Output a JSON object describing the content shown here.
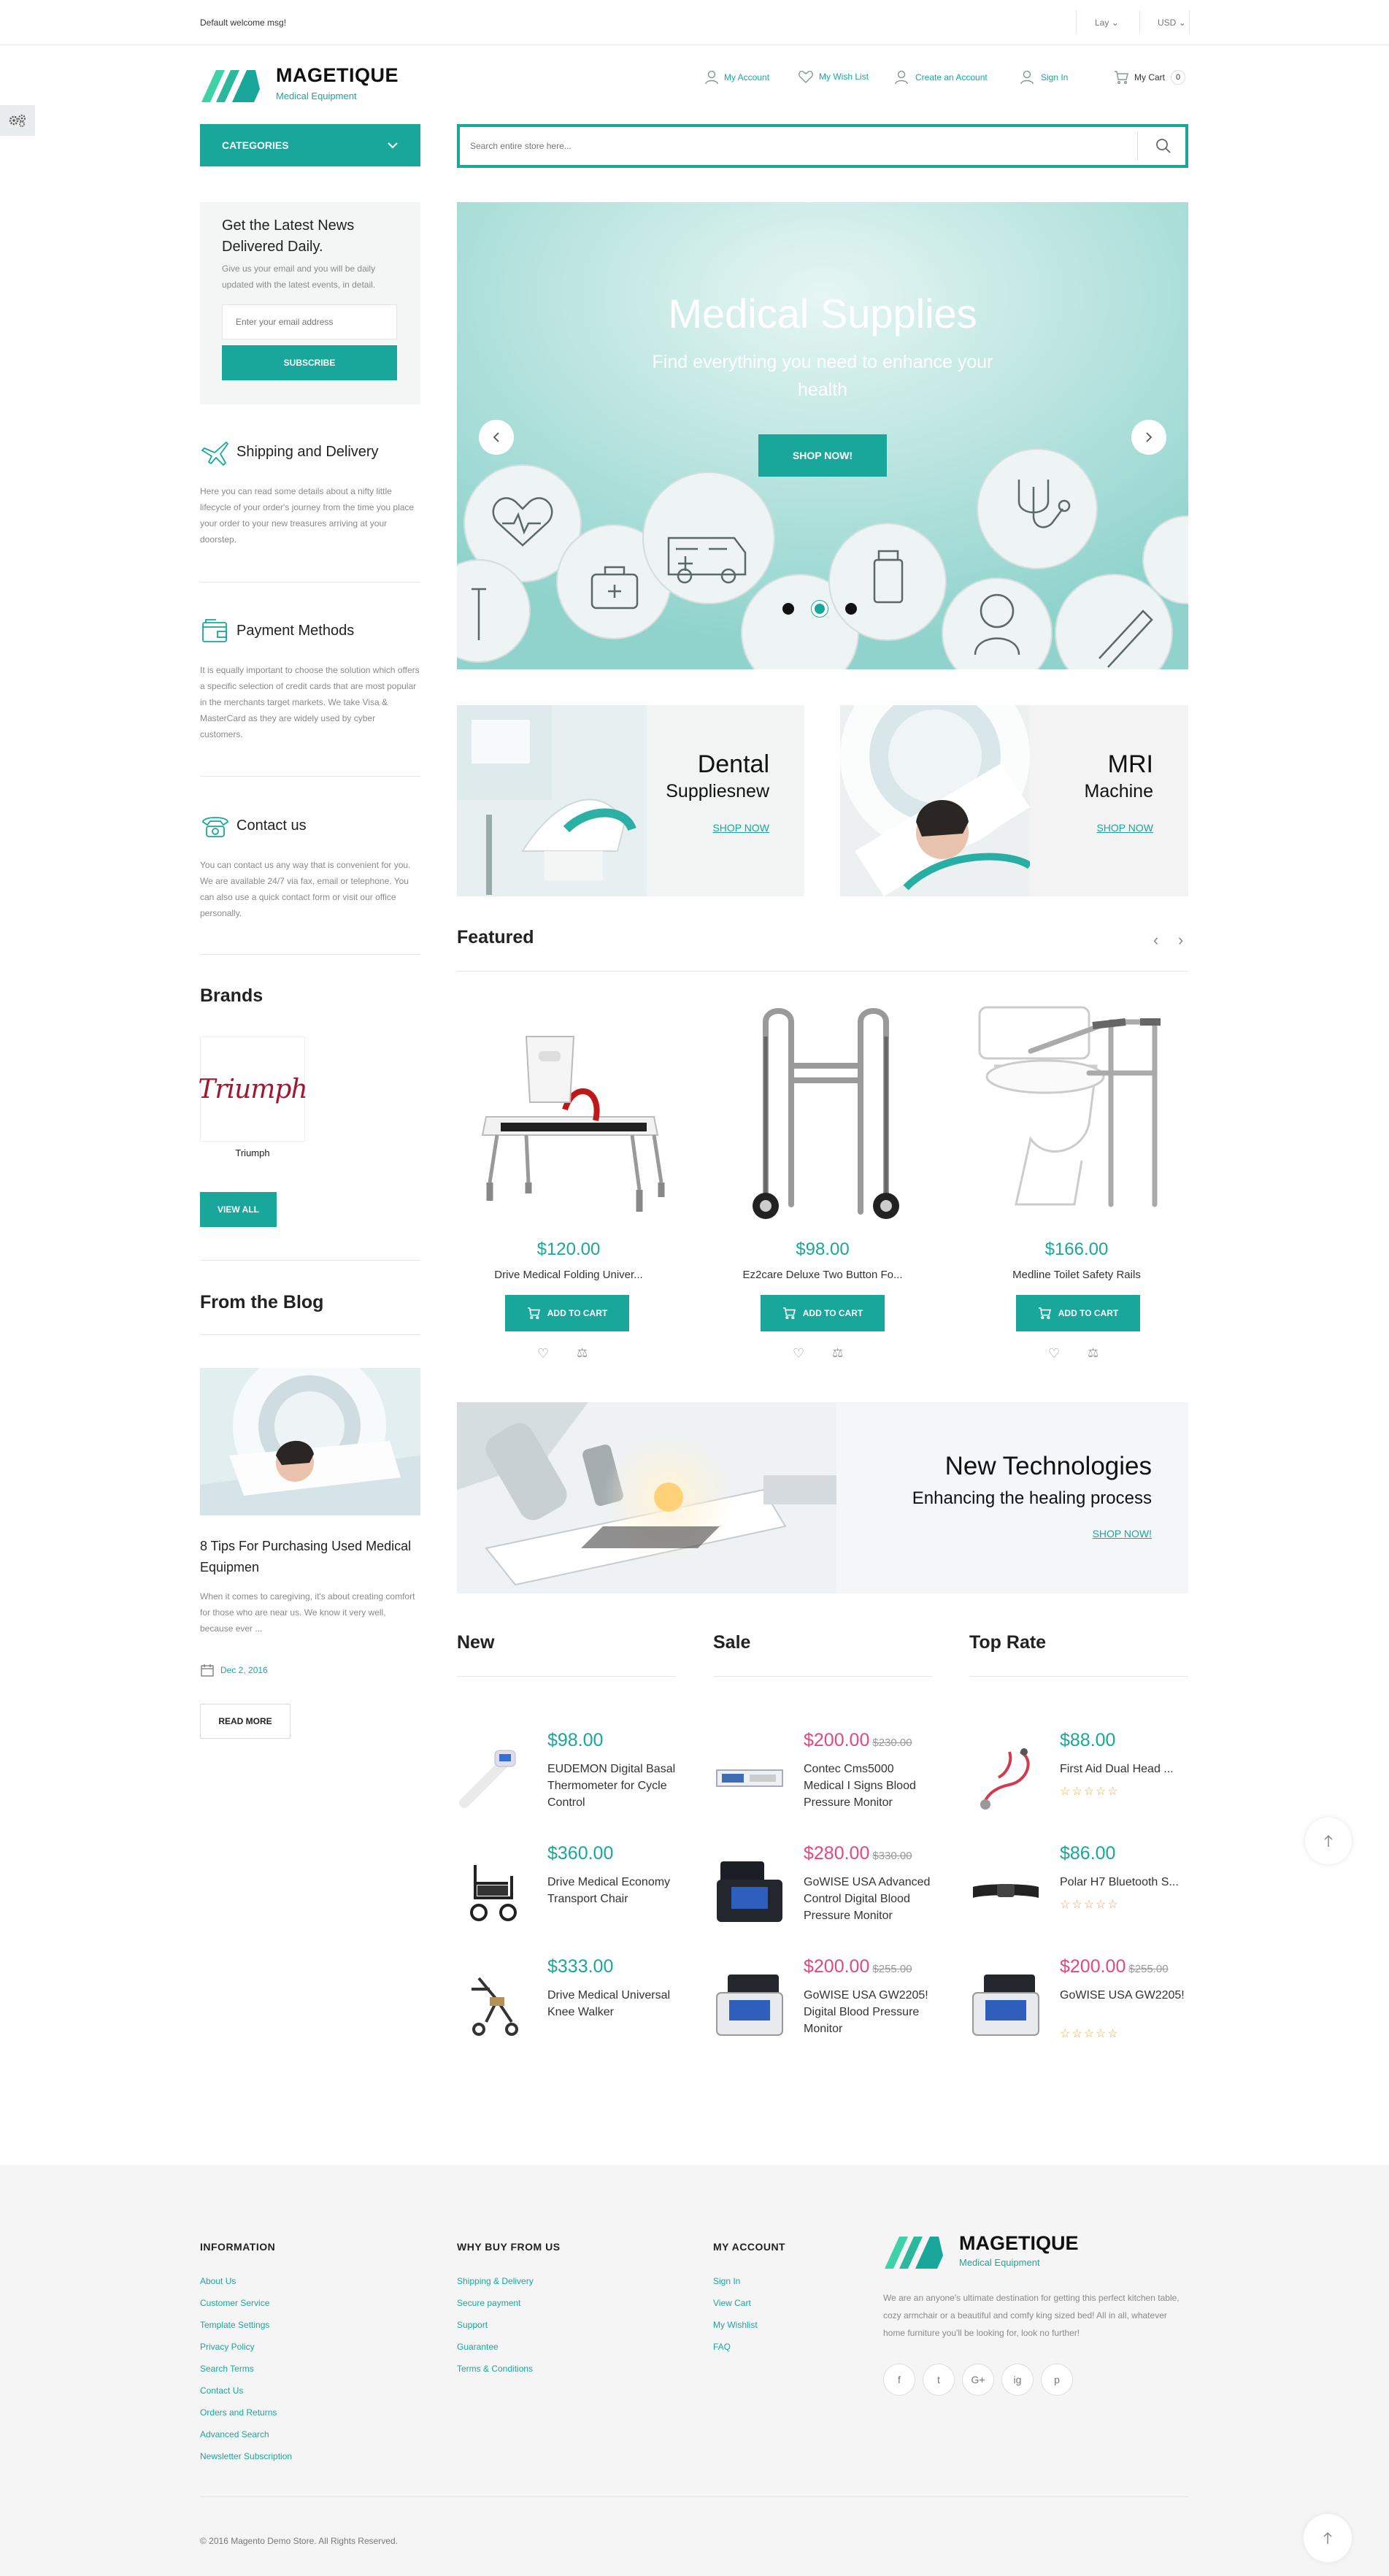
{
  "topbar": {
    "welcome": "Default welcome msg!",
    "language": "Lay",
    "currency": "USD"
  },
  "brand": {
    "name": "MAGETIQUE",
    "tagline": "Medical Equipment"
  },
  "header_links": {
    "account": "My Account",
    "wishlist": "My Wish List",
    "create": "Create an Account",
    "signin": "Sign In",
    "cart": "My Cart",
    "cart_count": "0"
  },
  "categories_label": "CATEGORIES",
  "search": {
    "placeholder": "Search entire store here..."
  },
  "newsletter": {
    "title": "Get the Latest News Delivered Daily.",
    "text": "Give us your email and you will be daily updated with the latest events, in detail.",
    "placeholder": "Enter your email address",
    "button": "SUBSCRIBE"
  },
  "info_blocks": [
    {
      "title": "Shipping and Delivery",
      "icon": "airplane-icon",
      "text": "Here you can read some details about a nifty little lifecycle of your order's journey from the time you place your order to your new treasures arriving at your doorstep."
    },
    {
      "title": "Payment Methods",
      "icon": "wallet-icon",
      "text": "It is equally important to choose the solution which offers a specific selection of credit cards that are most popular in the merchants target markets. We take Visa & MasterCard as they are widely used by cyber customers."
    },
    {
      "title": "Contact us",
      "icon": "phone-icon",
      "text": "You can contact us any way that is convenient for you. We are available 24/7 via fax, email or telephone. You can also use a quick contact form or visit our office personally."
    }
  ],
  "brands": {
    "title": "Brands",
    "logo_text": "Triumph",
    "name": "Triumph",
    "button": "VIEW ALL"
  },
  "blog": {
    "title": "From the Blog",
    "post_title": "8 Tips For Purchasing Used Medical Equipmen",
    "excerpt": "When it comes to caregiving, it's about creating comfort for those who are near us. We know it very well, because ever ...",
    "date": "Dec 2, 2016",
    "button": "READ MORE"
  },
  "hero": {
    "title": "Medical Supplies",
    "subtitle": "Find everything you need to enhance your health",
    "button": "SHOP NOW!",
    "slides": 3,
    "active_slide": 2
  },
  "banners": [
    {
      "title": "Dental",
      "subtitle": "Suppliesnew",
      "link": "SHOP NOW"
    },
    {
      "title": "MRI",
      "subtitle": "Machine",
      "link": "SHOP NOW"
    }
  ],
  "featured": {
    "title": "Featured",
    "add_label": "ADD TO CART",
    "products": [
      {
        "price": "$120.00",
        "name": "Drive Medical Folding Univer..."
      },
      {
        "price": "$98.00",
        "name": "Ez2care Deluxe Two Button Fo..."
      },
      {
        "price": "$166.00",
        "name": "Medline Toilet Safety Rails"
      }
    ]
  },
  "tech_banner": {
    "title": "New Technologies",
    "subtitle": "Enhancing the healing process",
    "link": "SHOP NOW!"
  },
  "lists": [
    {
      "title": "New",
      "items": [
        {
          "price": "$98.00",
          "old": "",
          "name": "EUDEMON Digital Basal Thermometer for Cycle Control"
        },
        {
          "price": "$360.00",
          "old": "",
          "name": "Drive Medical Economy Transport Chair"
        },
        {
          "price": "$333.00",
          "old": "",
          "name": "Drive Medical Universal Knee Walker"
        }
      ]
    },
    {
      "title": "Sale",
      "items": [
        {
          "price": "$200.00",
          "old": "$230.00",
          "name": "Contec Cms5000 Medical I Signs Blood Pressure Monitor"
        },
        {
          "price": "$280.00",
          "old": "$330.00",
          "name": "GoWISE USA Advanced Control Digital Blood Pressure Monitor"
        },
        {
          "price": "$200.00",
          "old": "$255.00",
          "name": "GoWISE USA GW2205! Digital Blood Pressure Monitor"
        }
      ]
    },
    {
      "title": "Top Rate",
      "items": [
        {
          "price": "$88.00",
          "old": "",
          "name": "First Aid Dual Head ...",
          "rating": 0
        },
        {
          "price": "$86.00",
          "old": "",
          "name": "Polar H7 Bluetooth S...",
          "rating": 0
        },
        {
          "price": "$200.00",
          "old": "$255.00",
          "name": "GoWISE USA GW2205! D...",
          "rating": 0
        }
      ]
    }
  ],
  "footer": {
    "information": {
      "title": "INFORMATION",
      "links": [
        "About Us",
        "Customer Service",
        "Template Settings",
        "Privacy Policy",
        "Search Terms",
        "Contact Us",
        "Orders and Returns",
        "Advanced Search",
        "Newsletter Subscription"
      ]
    },
    "why_buy": {
      "title": "WHY BUY FROM US",
      "links": [
        "Shipping & Delivery",
        "Secure payment",
        "Support",
        "Guarantee",
        "Terms & Conditions"
      ]
    },
    "my_account": {
      "title": "MY ACCOUNT",
      "links": [
        "Sign In",
        "View Cart",
        "My Wishlist",
        "FAQ"
      ]
    },
    "about": "We are an anyone's ultimate destination for getting this perfect kitchen table, cozy armchair or a beautiful and comfy king sized bed! All in all, whatever home furniture you'll be looking for, look no further!",
    "social": [
      "f",
      "t",
      "G+",
      "ig",
      "p"
    ],
    "copyright": "© 2016 Magento Demo Store. All Rights Reserved."
  },
  "colors": {
    "accent": "#1aa79b",
    "sale": "#e3487e",
    "footer_bg": "#f5f5f5"
  }
}
